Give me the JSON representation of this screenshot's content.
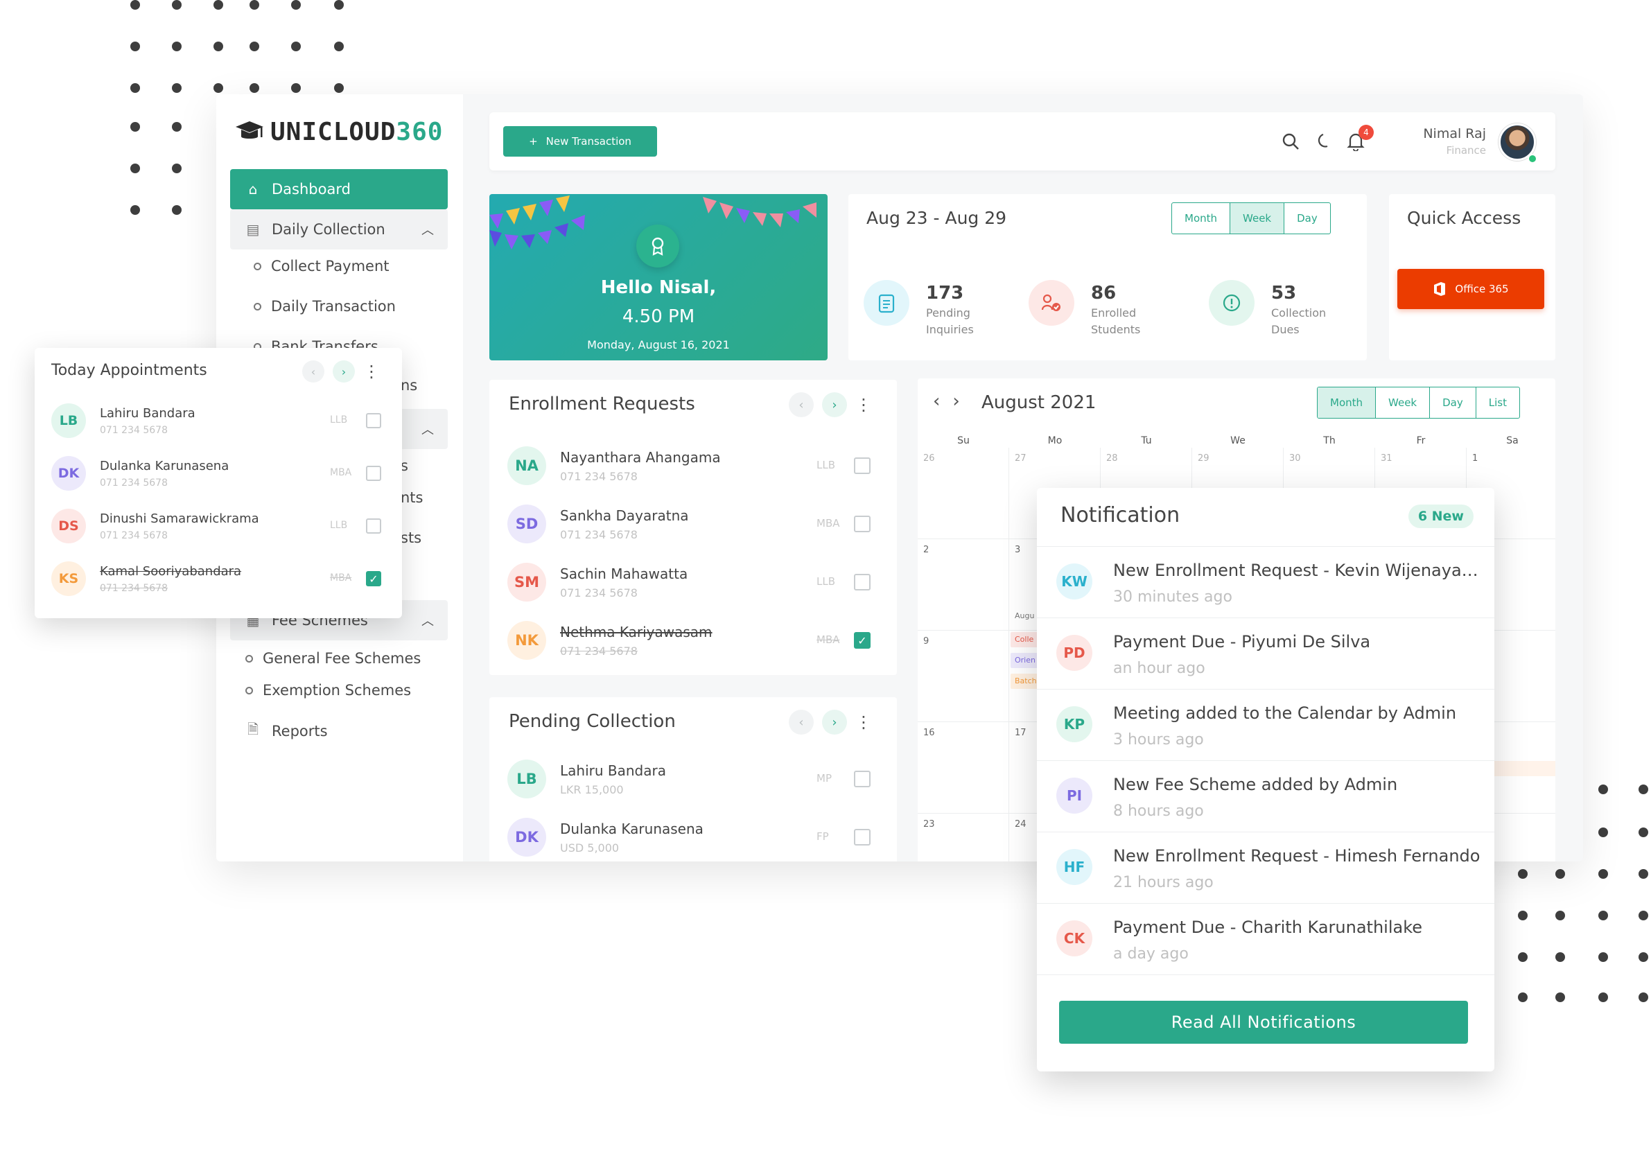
{
  "brand": {
    "logo_main": "UNICLOUD",
    "logo_num": "360"
  },
  "colors": {
    "accent": "#2aa88a",
    "office": "#eb3c00",
    "badge": "#ef4b3c"
  },
  "sidebar": {
    "dashboard": "Dashboard",
    "daily_collection": "Daily Collection",
    "collect_payment": "Collect Payment",
    "daily_transaction": "Daily Transaction",
    "bank_transfers": "Bank Transfers",
    "partial_ns": "ns",
    "partial_s": "s",
    "partial_nts": "nts",
    "partial_sts": "sts",
    "fee_schemes": "Fee Schemes",
    "general_fee_schemes": "General Fee Schemes",
    "exemption_schemes": "Exemption Schemes",
    "reports": "Reports"
  },
  "topbar": {
    "new_transaction": "New Transaction",
    "notification_count": "4",
    "user_name": "Nimal Raj",
    "user_role": "Finance"
  },
  "greeting": {
    "title": "Hello Nisal,",
    "time": "4.50  PM",
    "date": "Monday, August 16, 2021"
  },
  "stats": {
    "range": "Aug 23 - Aug 29",
    "views": [
      "Month",
      "Week",
      "Day"
    ],
    "active_view": "Week",
    "items": [
      {
        "value": "173",
        "label1": "Pending",
        "label2": "Inquiries"
      },
      {
        "value": "86",
        "label1": "Enrolled",
        "label2": "Students"
      },
      {
        "value": "53",
        "label1": "Collection",
        "label2": "Dues"
      }
    ]
  },
  "quick_access": {
    "title": "Quick Access",
    "office": "Office 365"
  },
  "enrollment": {
    "title": "Enrollment Requests",
    "rows": [
      {
        "initials": "NA",
        "name": "Nayanthara Ahangama",
        "phone": "071 234 5678",
        "tag": "LLB",
        "checked": false
      },
      {
        "initials": "SD",
        "name": "Sankha Dayaratna",
        "phone": "071 234 5678",
        "tag": "MBA",
        "checked": false
      },
      {
        "initials": "SM",
        "name": "Sachin Mahawatta",
        "phone": "071 234 5678",
        "tag": "LLB",
        "checked": false
      },
      {
        "initials": "NK",
        "name": "Nethma Kariyawasam",
        "phone": "071 234 5678",
        "tag": "MBA",
        "checked": true
      }
    ]
  },
  "pending": {
    "title": "Pending Collection",
    "rows": [
      {
        "initials": "LB",
        "name": "Lahiru Bandara",
        "amount": "LKR 15,000",
        "tag": "MP"
      },
      {
        "initials": "DK",
        "name": "Dulanka Karunasena",
        "amount": "USD 5,000",
        "tag": "FP"
      }
    ]
  },
  "calendar": {
    "title": "August 2021",
    "views": [
      "Month",
      "Week",
      "Day",
      "List"
    ],
    "active_view": "Month",
    "days": [
      "Su",
      "Mo",
      "Tu",
      "We",
      "Th",
      "Fr",
      "Sa"
    ],
    "week1": [
      "26",
      "27",
      "28",
      "29",
      "30",
      "31",
      "1"
    ],
    "week2_firsts": [
      "2",
      "3"
    ],
    "week3_first": "9",
    "week4": [
      "16",
      "17"
    ],
    "week5": [
      "23",
      "24"
    ],
    "event_label": "Augu",
    "events": [
      "Colle",
      "Orien",
      "Batch"
    ]
  },
  "appointments": {
    "title": "Today Appointments",
    "rows": [
      {
        "initials": "LB",
        "name": "Lahiru Bandara",
        "phone": "071 234 5678",
        "tag": "LLB",
        "checked": false
      },
      {
        "initials": "DK",
        "name": "Dulanka Karunasena",
        "phone": "071 234 5678",
        "tag": "MBA",
        "checked": false
      },
      {
        "initials": "DS",
        "name": "Dinushi Samarawickrama",
        "phone": "071 234 5678",
        "tag": "LLB",
        "checked": false
      },
      {
        "initials": "KS",
        "name": "Kamal Sooriyabandara",
        "phone": "071 234 5678",
        "tag": "MBA",
        "checked": true
      }
    ]
  },
  "notifications": {
    "title": "Notification",
    "new_count": "6 New",
    "items": [
      {
        "initials": "KW",
        "text": "New Enrollment Request - Kevin Wijenayake",
        "time": "30 minutes ago"
      },
      {
        "initials": "PD",
        "text": "Payment Due - Piyumi De Silva",
        "time": "an hour ago"
      },
      {
        "initials": "KP",
        "text": "Meeting added to the Calendar by Admin",
        "time": "3 hours ago"
      },
      {
        "initials": "PI",
        "text": "New Fee Scheme added by Admin",
        "time": "8 hours ago"
      },
      {
        "initials": "HF",
        "text": "New Enrollment Request - Himesh Fernando",
        "time": "21 hours ago"
      },
      {
        "initials": "CK",
        "text": "Payment Due - Charith Karunathilake",
        "time": "a day ago"
      }
    ],
    "read_all": "Read All Notifications"
  }
}
